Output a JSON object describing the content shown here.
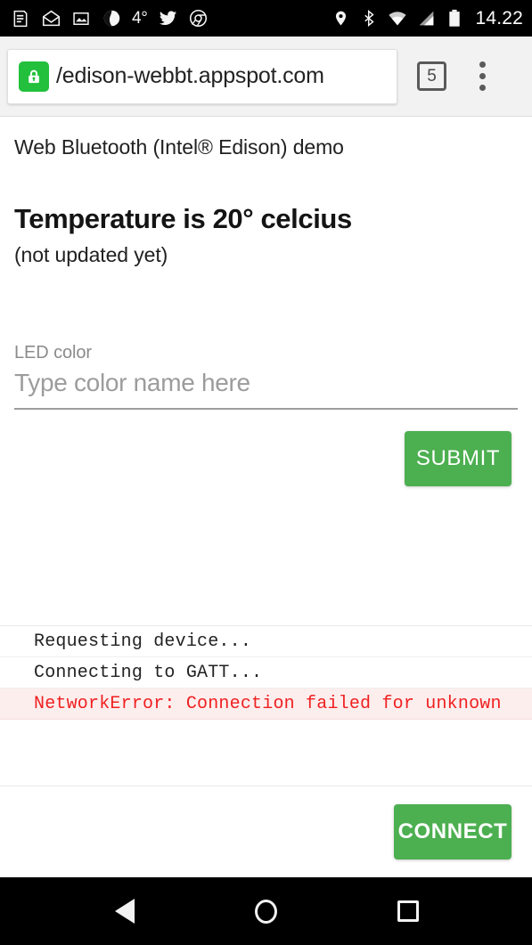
{
  "statusbar": {
    "icons": [
      {
        "name": "news-feed-icon"
      },
      {
        "name": "mail-open-icon"
      },
      {
        "name": "photo-icon"
      },
      {
        "name": "weather-app-icon"
      }
    ],
    "temperature": "4°",
    "social_icons": [
      {
        "name": "twitter-icon"
      },
      {
        "name": "chrome-icon"
      }
    ],
    "system_icons": [
      {
        "name": "location-pin-icon"
      },
      {
        "name": "bluetooth-icon"
      },
      {
        "name": "wifi-icon"
      },
      {
        "name": "cell-signal-icon"
      },
      {
        "name": "battery-icon"
      }
    ],
    "clock": "14.22"
  },
  "browser": {
    "lock_icon": "lock-icon",
    "url": "/edison-webbt.appspot.com",
    "tab_count": "5",
    "menu_icon": "overflow-menu-icon"
  },
  "page": {
    "demo_title": "Web Bluetooth (Intel® Edison) demo",
    "temperature_heading": "Temperature is 20° celcius",
    "temperature_status": "(not updated yet)",
    "form": {
      "label": "LED color",
      "placeholder": "Type color name here",
      "value": "",
      "submit_label": "SUBMIT"
    },
    "log": [
      {
        "text": "Requesting device...",
        "type": "info"
      },
      {
        "text": "Connecting to GATT...",
        "type": "info"
      },
      {
        "text": "NetworkError: Connection failed for unknown",
        "type": "error"
      }
    ],
    "connect_label": "CONNECT"
  },
  "navbar": {
    "back": "back-button",
    "home": "home-button",
    "recents": "recents-button"
  },
  "colors": {
    "accent_green": "#4CAF50",
    "lock_green": "#22C03C",
    "error_red": "#F02020",
    "error_bg": "#FDEEEE"
  }
}
